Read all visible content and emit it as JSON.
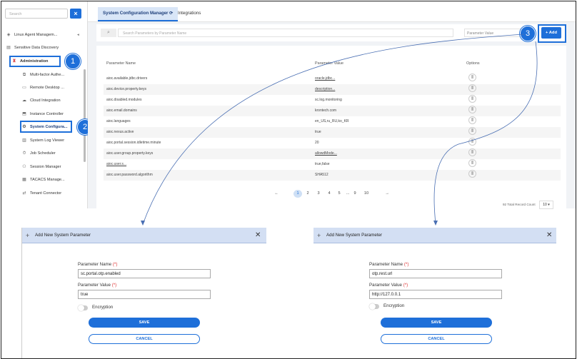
{
  "sidebar": {
    "search_placeholder": "Search",
    "clear_label": "×",
    "items": [
      {
        "label": "Linux Agent Managem...",
        "icon": "◈"
      },
      {
        "label": "Sensitive Data Discovery",
        "icon": "▤"
      },
      {
        "label": "Administration",
        "icon": "♜"
      },
      {
        "label": "Multi-factor Authe...",
        "icon": "⧉"
      },
      {
        "label": "Remote Desktop ...",
        "icon": "▭"
      },
      {
        "label": "Cloud Integration",
        "icon": "☁"
      },
      {
        "label": "Instance Controller",
        "icon": "⬒"
      },
      {
        "label": "System Configura...",
        "icon": "⚙"
      },
      {
        "label": "System Log Viewer",
        "icon": "▥"
      },
      {
        "label": "Job Scheduler",
        "icon": "⏱"
      },
      {
        "label": "Session Manager",
        "icon": "⚇"
      },
      {
        "label": "TACACS Manage...",
        "icon": "▦"
      },
      {
        "label": "Tenant Connector",
        "icon": "⇄"
      }
    ]
  },
  "tabs": [
    {
      "label": "System Configuration Manager ⟳"
    },
    {
      "label": "Integrations"
    }
  ],
  "search": {
    "placeholder": "Search Parameters by Parameter Name",
    "value_placeholder": "Parameter Value"
  },
  "add_button": "+ Add",
  "table": {
    "headers": [
      "Parameter Name",
      "Parameter Value",
      "Options"
    ],
    "rows": [
      {
        "name": "aioc.available.jdbc.drivers",
        "value": "oracle.jdbc..."
      },
      {
        "name": "aioc.device.property.keys",
        "value": "description..."
      },
      {
        "name": "aioc.disabled.modules",
        "value": "sc.log.monitoring"
      },
      {
        "name": "aioc.email.domains",
        "value": "krontech.com"
      },
      {
        "name": "aioc.languages",
        "value": "en_US,ru_RU,ko_KR"
      },
      {
        "name": "aioc.nexus.active",
        "value": "true"
      },
      {
        "name": "aioc.portal.session.idletime.minute",
        "value": "20"
      },
      {
        "name": "aioc.user.group.property.keys",
        "value": "allowdMode..."
      },
      {
        "name": "aioc.user.s...",
        "value": "true,false"
      },
      {
        "name": "aioc.user.password.algorithm",
        "value": "SHA512"
      }
    ],
    "option_glyph": "|||"
  },
  "pagination": {
    "prev": "←",
    "pages": [
      "1",
      "2",
      "3",
      "4",
      "5",
      "...",
      "9",
      "10"
    ],
    "next": "→",
    "total": "92 Total Record Count",
    "page_size": "10 ▾"
  },
  "callouts": [
    "1",
    "2",
    "3"
  ],
  "dialog_left": {
    "title": "Add New System Parameter",
    "close": "✕",
    "name_label": "Parameter Name",
    "name_value": "sc.portal.otp.enabled",
    "value_label": "Parameter Value",
    "value_value": "true",
    "encryption_label": "Encryption",
    "save": "SAVE",
    "cancel": "CANCEL"
  },
  "dialog_right": {
    "title": "Add New System Parameter",
    "close": "✕",
    "name_label": "Parameter Name",
    "name_value": "otp.rest.url",
    "value_label": "Parameter Value",
    "value_value": "http://127.0.0.1",
    "encryption_label": "Encryption",
    "save": "SAVE",
    "cancel": "CANCEL"
  },
  "required_mark": "(*)",
  "colors": {
    "accent": "#1e6fd9",
    "dialog_header": "#d3dff3"
  }
}
